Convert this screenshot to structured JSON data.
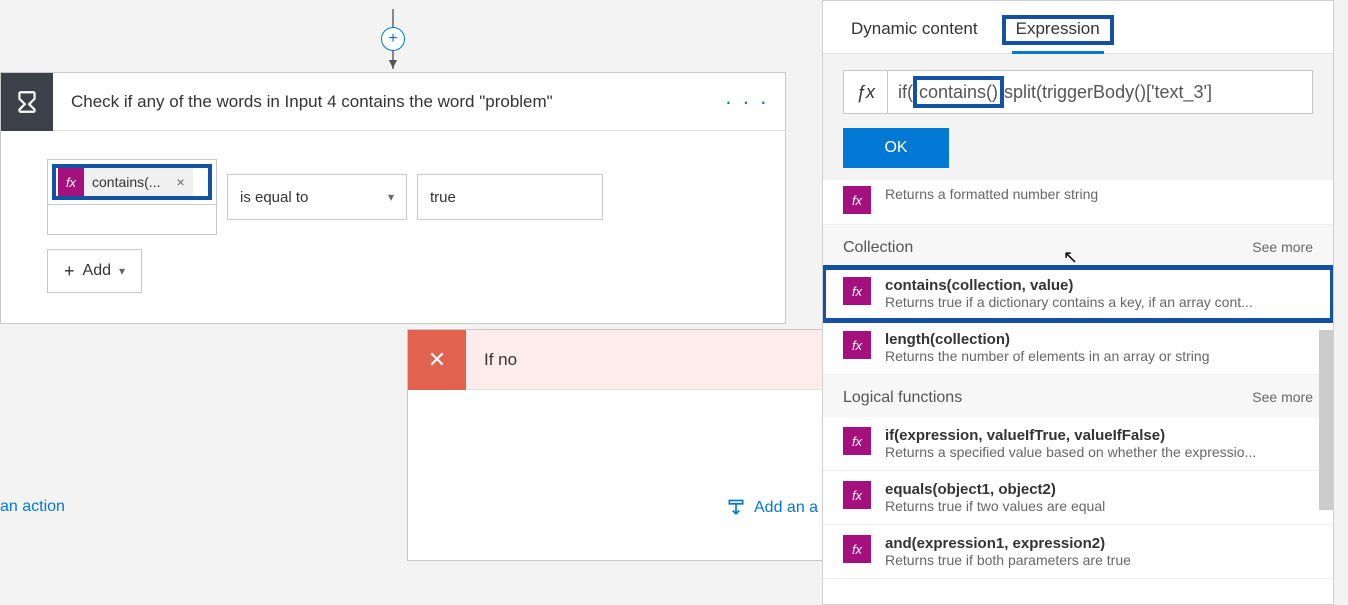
{
  "condition": {
    "title": "Check if any of the words in Input 4 contains the word \"problem\"",
    "token_label": "contains(...",
    "operator": "is equal to",
    "value": "true",
    "add_label": "Add"
  },
  "ifno": {
    "title": "If no"
  },
  "links": {
    "left_action": "an action",
    "right_action": "Add an a"
  },
  "panel": {
    "tab_dynamic": "Dynamic content",
    "tab_expression": "Expression",
    "expr_prefix": "if(",
    "expr_hl": "contains()",
    "expr_suffix": "split(triggerBody()['text_3']",
    "ok": "OK",
    "top_partial_desc": "Returns a formatted number string",
    "cat_collection": "Collection",
    "cat_logical": "Logical functions",
    "see_more": "See more",
    "fns": {
      "contains": {
        "name": "contains(collection, value)",
        "desc": "Returns true if a dictionary contains a key, if an array cont..."
      },
      "length": {
        "name": "length(collection)",
        "desc": "Returns the number of elements in an array or string"
      },
      "if": {
        "name": "if(expression, valueIfTrue, valueIfFalse)",
        "desc": "Returns a specified value based on whether the expressio..."
      },
      "equals": {
        "name": "equals(object1, object2)",
        "desc": "Returns true if two values are equal"
      },
      "and": {
        "name": "and(expression1, expression2)",
        "desc": "Returns true if both parameters are true"
      }
    }
  }
}
